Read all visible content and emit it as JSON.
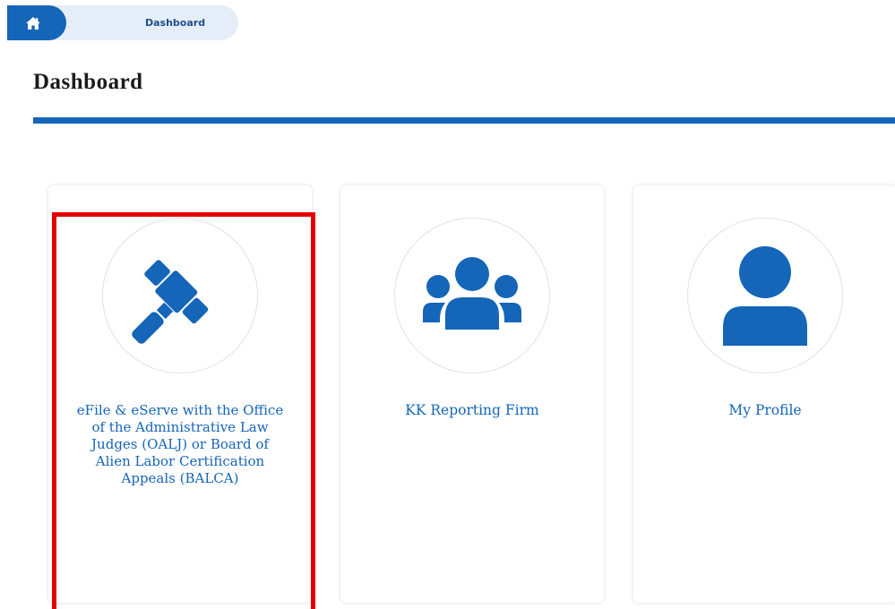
{
  "breadcrumb": {
    "home_icon": "home-icon",
    "current": "Dashboard"
  },
  "page": {
    "title": "Dashboard"
  },
  "colors": {
    "primary": "#1565b8",
    "breadcrumb_bg": "#e5eef8",
    "highlight": "#e60000"
  },
  "cards": [
    {
      "icon": "gavel-icon",
      "label": "eFile & eServe with the Office of the Administrative Law Judges (OALJ) or Board of Alien Labor Certification Appeals (BALCA)"
    },
    {
      "icon": "users-group-icon",
      "label": "KK Reporting Firm"
    },
    {
      "icon": "user-icon",
      "label": "My Profile"
    }
  ]
}
